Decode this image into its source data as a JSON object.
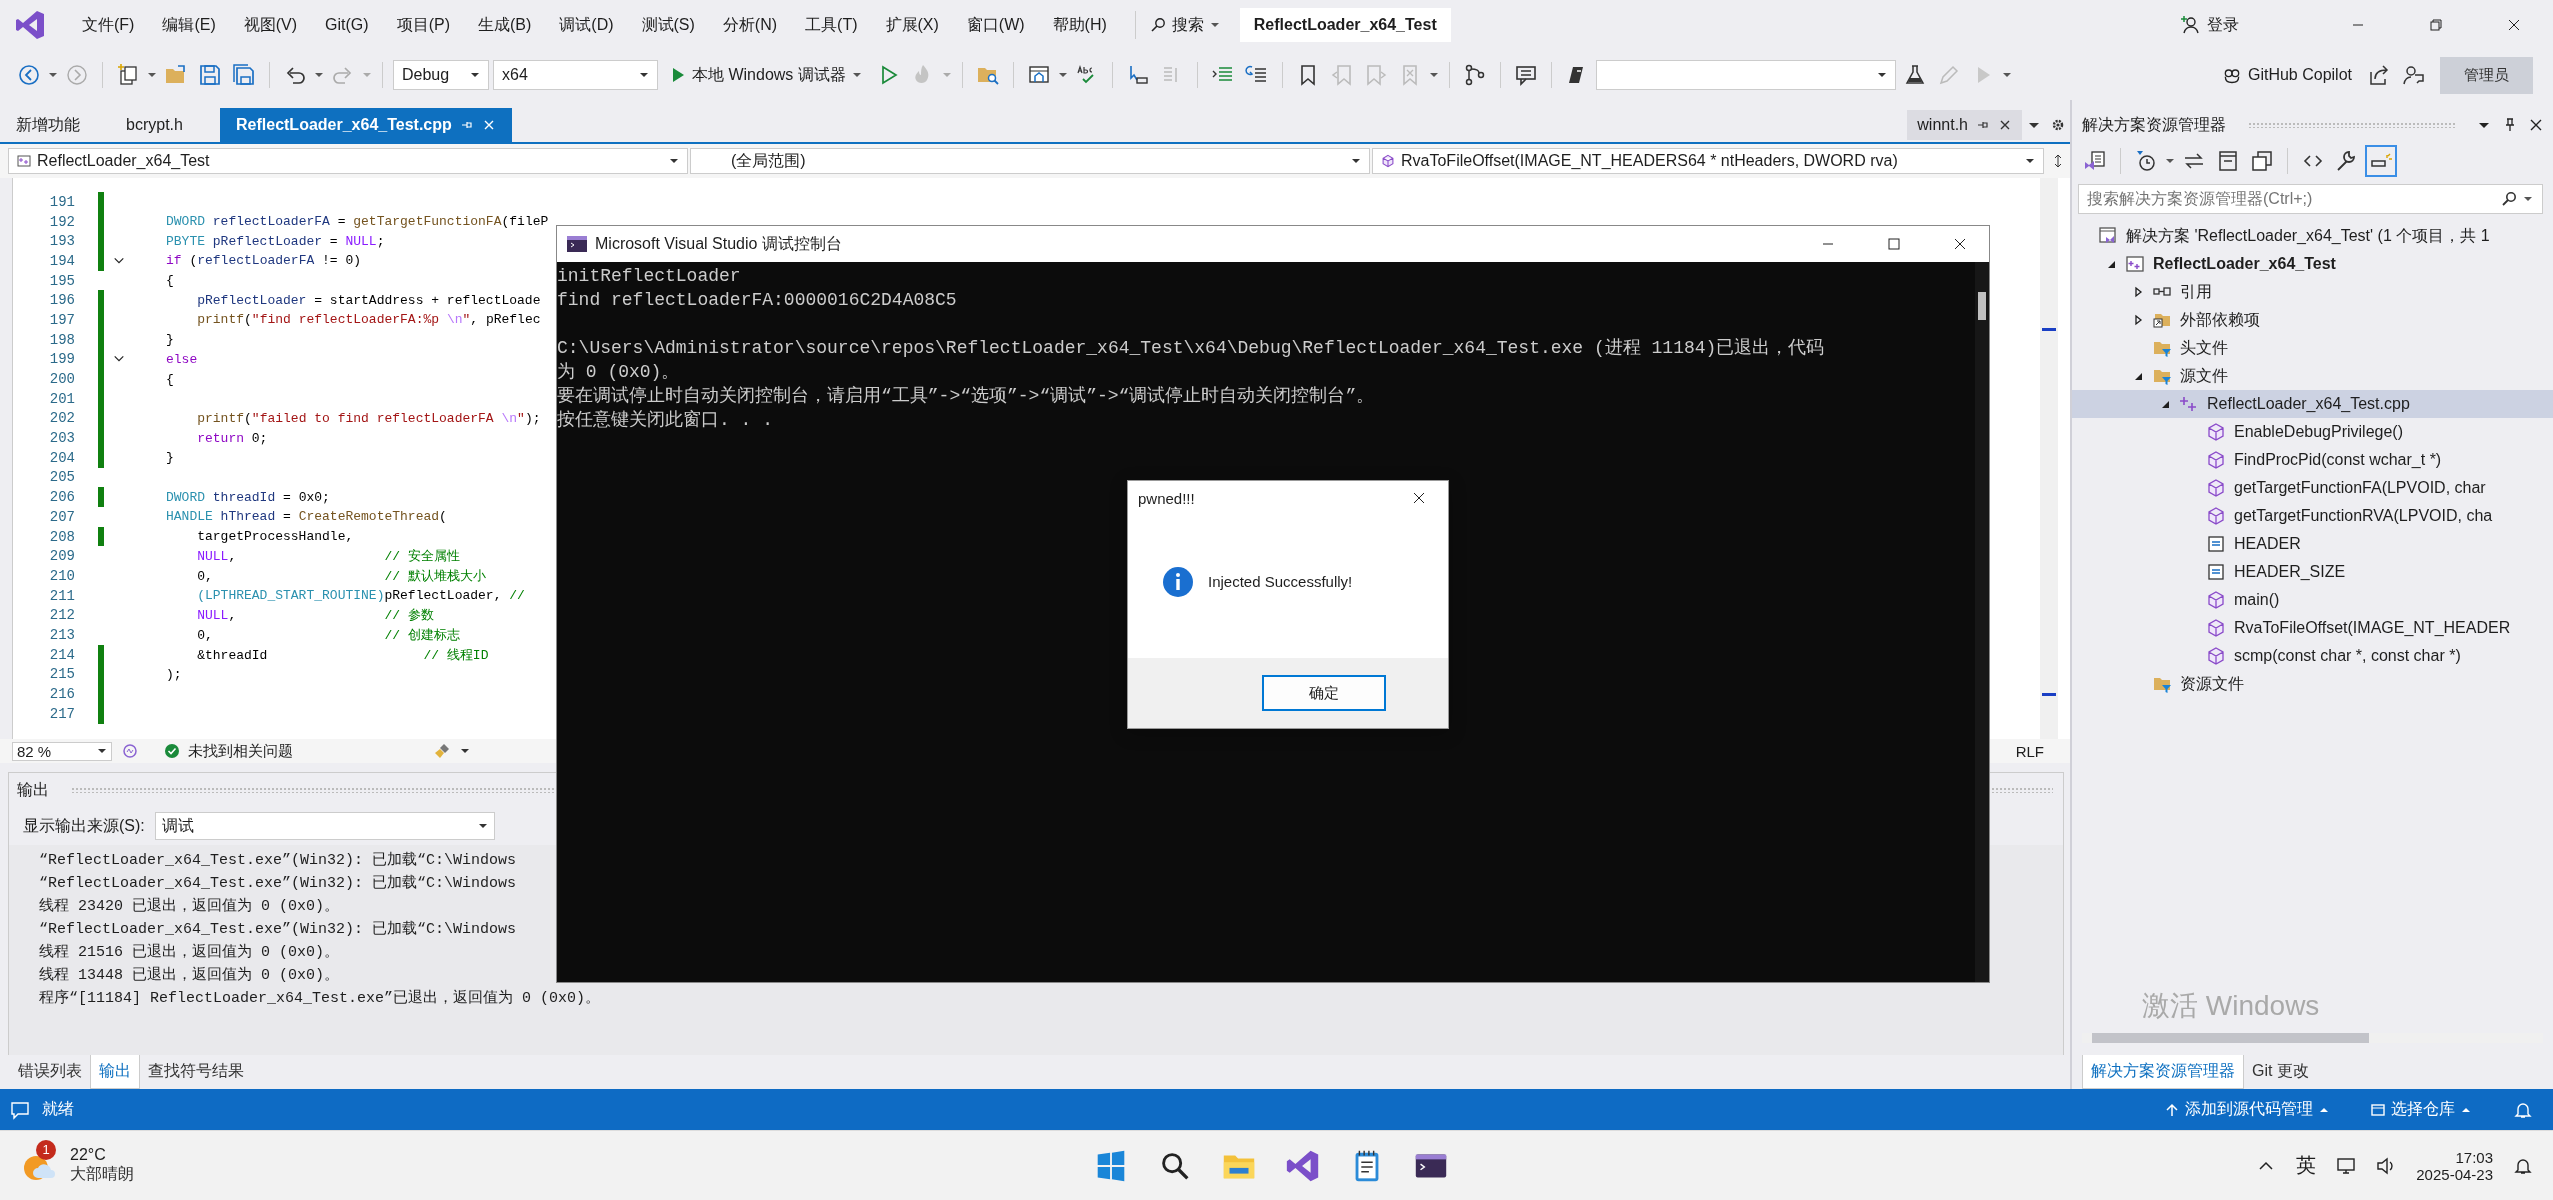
{
  "title_bar": {
    "menu": [
      "文件(F)",
      "编辑(E)",
      "视图(V)",
      "Git(G)",
      "项目(P)",
      "生成(B)",
      "调试(D)",
      "测试(S)",
      "分析(N)",
      "工具(T)",
      "扩展(X)",
      "窗口(W)",
      "帮助(H)"
    ],
    "search": "搜索",
    "solution_name": "ReflectLoader_x64_Test",
    "sign_in": "登录"
  },
  "toolbar": {
    "configuration": "Debug",
    "platform": "x64",
    "run_label": "本地 Windows 调试器",
    "copilot": "GitHub Copilot",
    "admin_badge": "管理员"
  },
  "doc_tabs": [
    {
      "label": "新增功能",
      "selected": false
    },
    {
      "label": "bcrypt.h",
      "selected": false
    },
    {
      "label": "ReflectLoader_x64_Test.cpp",
      "selected": true
    }
  ],
  "preview_tab": {
    "label": "winnt.h"
  },
  "nav_bar": {
    "project": "ReflectLoader_x64_Test",
    "scope": "(全局范围)",
    "member": "RvaToFileOffset(IMAGE_NT_HEADERS64 * ntHeaders, DWORD rva)"
  },
  "editor": {
    "lines": [
      {
        "num": "191",
        "changed": true
      },
      {
        "num": "192",
        "changed": true,
        "seg": [
          {
            "kind": "type",
            "text": "DWORD"
          },
          {
            "kind": "var",
            "text": " reflectLoaderFA"
          },
          {
            "kind": "plain",
            "text": " = "
          },
          {
            "kind": "fn",
            "text": "getTargetFunctionFA"
          },
          {
            "kind": "plain",
            "text": "(fileP"
          }
        ]
      },
      {
        "num": "193",
        "changed": true,
        "seg": [
          {
            "kind": "type",
            "text": "PBYTE"
          },
          {
            "kind": "var",
            "text": " pReflectLoader"
          },
          {
            "kind": "plain",
            "text": " = "
          },
          {
            "kind": "macro",
            "text": "NULL"
          },
          {
            "kind": "plain",
            "text": ";"
          }
        ]
      },
      {
        "num": "194",
        "changed": true,
        "fold": true,
        "seg": [
          {
            "kind": "control",
            "text": "if"
          },
          {
            "kind": "plain",
            "text": " ("
          },
          {
            "kind": "var",
            "text": "reflectLoaderFA"
          },
          {
            "kind": "plain",
            "text": " != 0)"
          }
        ]
      },
      {
        "num": "195",
        "changed": false,
        "seg": [
          {
            "kind": "plain",
            "text": "{"
          }
        ]
      },
      {
        "num": "196",
        "changed": true,
        "indented": true,
        "seg": [
          {
            "kind": "var",
            "text": "pReflectLoader"
          },
          {
            "kind": "plain",
            "text": " = startAddress + reflectLoade"
          }
        ]
      },
      {
        "num": "197",
        "changed": true,
        "indented": true,
        "seg": [
          {
            "kind": "fn",
            "text": "printf"
          },
          {
            "kind": "plain",
            "text": "("
          },
          {
            "kind": "string",
            "text": "\"find reflectLoaderFA:%p "
          },
          {
            "kind": "escape",
            "text": "\\n"
          },
          {
            "kind": "string",
            "text": "\""
          },
          {
            "kind": "plain",
            "text": ", pReflec"
          }
        ]
      },
      {
        "num": "198",
        "changed": true,
        "seg": [
          {
            "kind": "plain",
            "text": "}"
          }
        ]
      },
      {
        "num": "199",
        "changed": true,
        "fold": true,
        "seg": [
          {
            "kind": "control",
            "text": "else"
          }
        ]
      },
      {
        "num": "200",
        "changed": true,
        "seg": [
          {
            "kind": "plain",
            "text": "{"
          }
        ]
      },
      {
        "num": "201",
        "changed": true
      },
      {
        "num": "202",
        "changed": true,
        "indented": true,
        "seg": [
          {
            "kind": "fn",
            "text": "printf"
          },
          {
            "kind": "plain",
            "text": "("
          },
          {
            "kind": "string",
            "text": "\"failed to find reflectLoaderFA "
          },
          {
            "kind": "escape",
            "text": "\\n"
          },
          {
            "kind": "string",
            "text": "\""
          },
          {
            "kind": "plain",
            "text": ");"
          }
        ]
      },
      {
        "num": "203",
        "changed": true,
        "indented": true,
        "seg": [
          {
            "kind": "control",
            "text": "return"
          },
          {
            "kind": "plain",
            "text": " 0;"
          }
        ]
      },
      {
        "num": "204",
        "changed": true,
        "seg": [
          {
            "kind": "plain",
            "text": "}"
          }
        ]
      },
      {
        "num": "205",
        "changed": false
      },
      {
        "num": "206",
        "changed": true,
        "seg": [
          {
            "kind": "type",
            "text": "DWORD"
          },
          {
            "kind": "var",
            "text": " threadId"
          },
          {
            "kind": "plain",
            "text": " = 0x0;"
          }
        ]
      },
      {
        "num": "207",
        "changed": false,
        "seg": [
          {
            "kind": "type",
            "text": "HANDLE"
          },
          {
            "kind": "var",
            "text": " hThread"
          },
          {
            "kind": "plain",
            "text": " = "
          },
          {
            "kind": "fn",
            "text": "CreateRemoteThread"
          },
          {
            "kind": "plain",
            "text": "("
          }
        ]
      },
      {
        "num": "208",
        "changed": true,
        "indented": true,
        "seg": [
          {
            "kind": "plain",
            "text": "targetProcessHandle,"
          }
        ]
      },
      {
        "num": "209",
        "changed": false,
        "indented": true,
        "seg": [
          {
            "kind": "macro",
            "text": "NULL"
          },
          {
            "kind": "plain",
            "text": ","
          },
          {
            "kind": "comment",
            "text": "                   // 安全属性"
          }
        ]
      },
      {
        "num": "210",
        "changed": false,
        "indented": true,
        "seg": [
          {
            "kind": "plain",
            "text": "0,"
          },
          {
            "kind": "comment",
            "text": "                      // 默认堆栈大小"
          }
        ]
      },
      {
        "num": "211",
        "changed": false,
        "indented": true,
        "seg": [
          {
            "kind": "type",
            "text": "(LPTHREAD_START_ROUTINE)"
          },
          {
            "kind": "plain",
            "text": "pReflectLoader, "
          },
          {
            "kind": "comment",
            "text": "//"
          }
        ]
      },
      {
        "num": "212",
        "changed": false,
        "indented": true,
        "seg": [
          {
            "kind": "macro",
            "text": "NULL"
          },
          {
            "kind": "plain",
            "text": ","
          },
          {
            "kind": "comment",
            "text": "                   // 参数"
          }
        ]
      },
      {
        "num": "213",
        "changed": false,
        "indented": true,
        "seg": [
          {
            "kind": "plain",
            "text": "0,"
          },
          {
            "kind": "comment",
            "text": "                      // 创建标志"
          }
        ]
      },
      {
        "num": "214",
        "changed": true,
        "indented": true,
        "seg": [
          {
            "kind": "plain",
            "text": "&threadId"
          },
          {
            "kind": "comment",
            "text": "                    // 线程ID"
          }
        ]
      },
      {
        "num": "215",
        "changed": true,
        "seg": [
          {
            "kind": "plain",
            "text": ");"
          }
        ]
      },
      {
        "num": "216",
        "changed": true
      },
      {
        "num": "217",
        "changed": true
      }
    ]
  },
  "editor_status": {
    "zoom": "82 %",
    "issues": "未找到相关问题",
    "line_ending": "RLF"
  },
  "output": {
    "title": "输出",
    "source_label": "显示输出来源(S):",
    "source": "调试",
    "lines": [
      "“ReflectLoader_x64_Test.exe”(Win32): 已加载“C:\\Windows",
      "“ReflectLoader_x64_Test.exe”(Win32): 已加载“C:\\Windows",
      "线程 23420 已退出，返回值为 0 (0x0)。",
      "“ReflectLoader_x64_Test.exe”(Win32): 已加载“C:\\Windows",
      "线程 21516 已退出，返回值为 0 (0x0)。",
      "线程 13448 已退出，返回值为 0 (0x0)。",
      "程序“[11184] ReflectLoader_x64_Test.exe”已退出，返回值为 0 (0x0)。"
    ]
  },
  "bottom_tabs": [
    {
      "label": "错误列表",
      "selected": false
    },
    {
      "label": "输出",
      "selected": true
    },
    {
      "label": "查找符号结果",
      "selected": false
    }
  ],
  "console_window": {
    "title": "Microsoft Visual Studio 调试控制台",
    "lines": [
      "initReflectLoader",
      "find reflectLoaderFA:0000016C2D4A08C5"
    ],
    "exit_lines": [
      "C:\\Users\\Administrator\\source\\repos\\ReflectLoader_x64_Test\\x64\\Debug\\ReflectLoader_x64_Test.exe (进程 11184)已退出，代码",
      "为 0 (0x0)。",
      "要在调试停止时自动关闭控制台，请启用“工具”->“选项”->“调试”->“调试停止时自动关闭控制台”。",
      "按任意键关闭此窗口. . ."
    ]
  },
  "dialog": {
    "title": "pwned!!!",
    "message": "Injected Successfully!",
    "button": "确定"
  },
  "solution_explorer": {
    "title": "解决方案资源管理器",
    "search_placeholder": "搜索解决方案资源管理器(Ctrl+;)",
    "tree": [
      {
        "kind": "solution",
        "label": "解决方案 'ReflectLoader_x64_Test' (1 个项目，共 1",
        "selected": false,
        "children": [
          {
            "kind": "project",
            "label": "ReflectLoader_x64_Test",
            "selected": false,
            "expanded": true,
            "children": [
              {
                "kind": "references",
                "label": "引用",
                "selected": false,
                "expanded": false
              },
              {
                "kind": "external",
                "label": "外部依赖项",
                "selected": false,
                "expanded": false
              },
              {
                "kind": "filter",
                "label": "头文件",
                "selected": false
              },
              {
                "kind": "filter",
                "label": "源文件",
                "selected": false,
                "expanded": true,
                "children": [
                  {
                    "kind": "cpp",
                    "label": "ReflectLoader_x64_Test.cpp",
                    "selected": true,
                    "expanded": true,
                    "children": [
                      {
                        "kind": "method",
                        "label": "EnableDebugPrivilege()",
                        "selected": false
                      },
                      {
                        "kind": "method",
                        "label": "FindProcPid(const wchar_t *)",
                        "selected": false
                      },
                      {
                        "kind": "method",
                        "label": "getTargetFunctionFA(LPVOID, char",
                        "selected": false
                      },
                      {
                        "kind": "method",
                        "label": "getTargetFunctionRVA(LPVOID, cha",
                        "selected": false
                      },
                      {
                        "kind": "field",
                        "label": "HEADER",
                        "selected": false
                      },
                      {
                        "kind": "field",
                        "label": "HEADER_SIZE",
                        "selected": false
                      },
                      {
                        "kind": "method",
                        "label": "main()",
                        "selected": false
                      },
                      {
                        "kind": "method",
                        "label": "RvaToFileOffset(IMAGE_NT_HEADER",
                        "selected": false
                      },
                      {
                        "kind": "method",
                        "label": "scmp(const char *, const char *)",
                        "selected": false
                      }
                    ]
                  }
                ]
              },
              {
                "kind": "filter",
                "label": "资源文件",
                "selected": false
              }
            ]
          }
        ]
      }
    ]
  },
  "explorer_tabs": [
    {
      "label": "解决方案资源管理器",
      "selected": true
    },
    {
      "label": "Git 更改",
      "selected": false
    }
  ],
  "activation_notice": "激活 Windows",
  "status_bar": {
    "text": "就绪",
    "source_control": "添加到源代码管理",
    "repository": "选择仓库"
  },
  "taskbar": {
    "weather": {
      "temperature": "22°C",
      "condition": "大部晴朗",
      "badge": "1"
    },
    "input_language": "英",
    "time": "17:03",
    "date": "2025-04-23"
  }
}
